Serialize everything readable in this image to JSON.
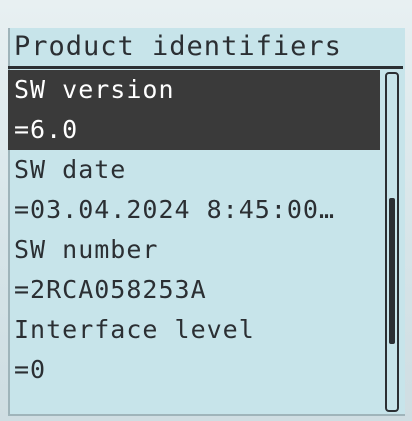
{
  "screen": {
    "title": "Product identifiers",
    "items": [
      {
        "label": "SW version",
        "value": "=6.0",
        "selected": true
      },
      {
        "label": "SW date",
        "value": "=03.04.2024 8:45:00…",
        "selected": false
      },
      {
        "label": "SW number",
        "value": "=2RCA058253A",
        "selected": false
      },
      {
        "label": "Interface level",
        "value": "=0",
        "selected": false
      }
    ],
    "scroll_position": 0.35
  },
  "colors": {
    "background": "#c7e4ea",
    "text": "#2b2f33",
    "selection": "#3a3a3a"
  }
}
